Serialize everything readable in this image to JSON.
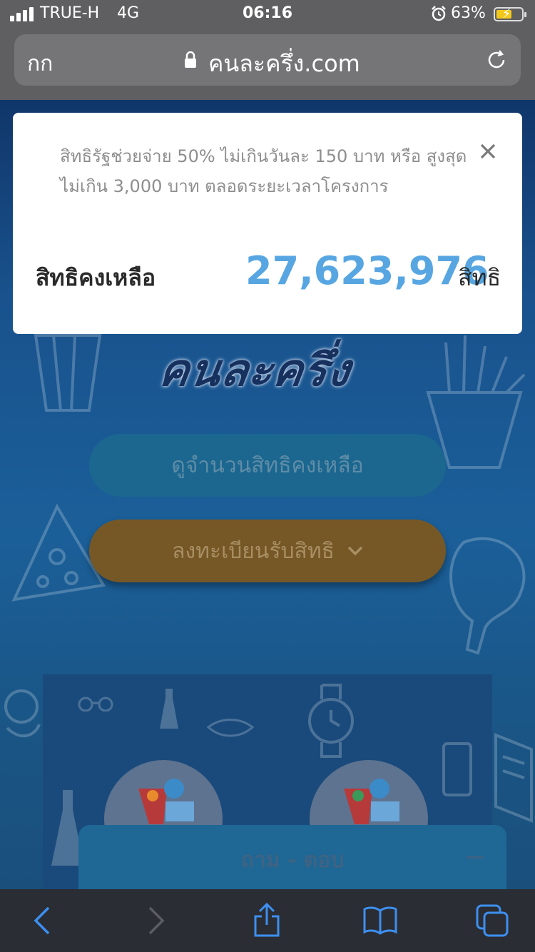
{
  "status_bar": {
    "carrier": "TRUE-H",
    "network": "4G",
    "time": "06:16",
    "battery_percent": "63%",
    "battery_level": 0.63,
    "icons": [
      "signal-icon",
      "alarm-icon",
      "battery-charging-icon"
    ]
  },
  "browser": {
    "text_size_label": "กก",
    "url": "คนละครึ่ง.com",
    "icons": [
      "lock-icon",
      "reload-icon"
    ]
  },
  "page": {
    "logo_text": "คนละครึ่ง",
    "check_button_label": "ดูจำนวนสิทธิคงเหลือ",
    "register_button_label": "ลงทะเบียนรับสิทธิ",
    "qa_label": "ถาม - ตอบ"
  },
  "popup": {
    "description": "สิทธิรัฐช่วยจ่าย 50% ไม่เกินวันละ 150 บาท หรือ สูงสุดไม่เกิน 3,000 บาท ตลอดระยะเวลาโครงการ",
    "remaining_label": "สิทธิคงเหลือ",
    "remaining_count": "27,623,976",
    "unit": "สิทธิ"
  },
  "toolbar": {
    "icons": [
      "back-icon",
      "forward-icon",
      "share-icon",
      "bookmarks-icon",
      "tabs-icon"
    ]
  },
  "colors": {
    "accent_blue": "#57a6e2",
    "register_gold": "#765827",
    "page_navy": "#19528d"
  }
}
